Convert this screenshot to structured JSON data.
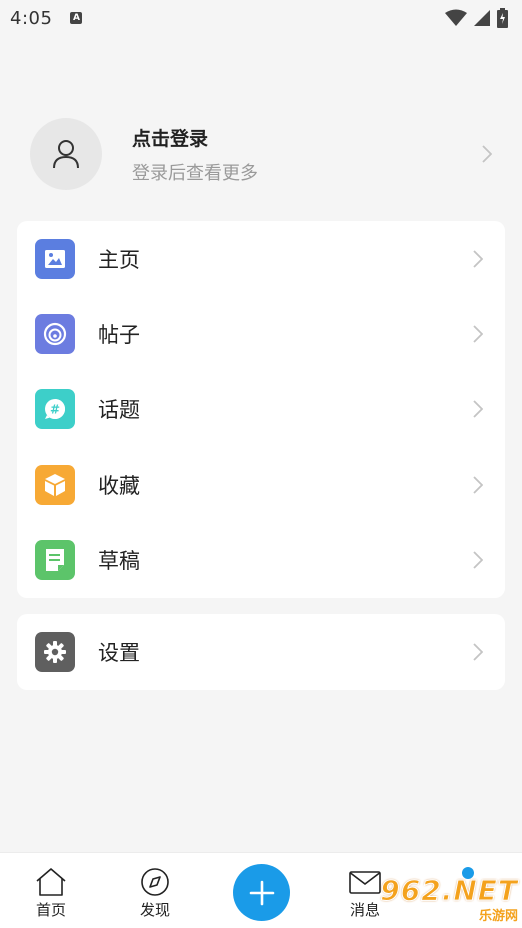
{
  "status_bar": {
    "time": "4:05"
  },
  "profile": {
    "title": "点击登录",
    "subtitle": "登录后查看更多"
  },
  "menu": [
    {
      "label": "主页",
      "icon": "image-icon",
      "color": "#5b7ee0"
    },
    {
      "label": "帖子",
      "icon": "spiral-icon",
      "color": "#6c7ce0"
    },
    {
      "label": "话题",
      "icon": "hash-chat-icon",
      "color": "#3dcfc9"
    },
    {
      "label": "收藏",
      "icon": "box-icon",
      "color": "#f7a935"
    },
    {
      "label": "草稿",
      "icon": "document-icon",
      "color": "#5cc46a"
    }
  ],
  "settings": {
    "label": "设置",
    "icon": "gear-icon",
    "color": "#5f5f5f"
  },
  "bottom_nav": {
    "home": "首页",
    "discover": "发现",
    "messages": "消息"
  },
  "watermark": {
    "logo": "962.NET",
    "sub": "乐游网"
  },
  "colors": {
    "accent": "#1a9be8",
    "background": "#f5f5f5"
  }
}
